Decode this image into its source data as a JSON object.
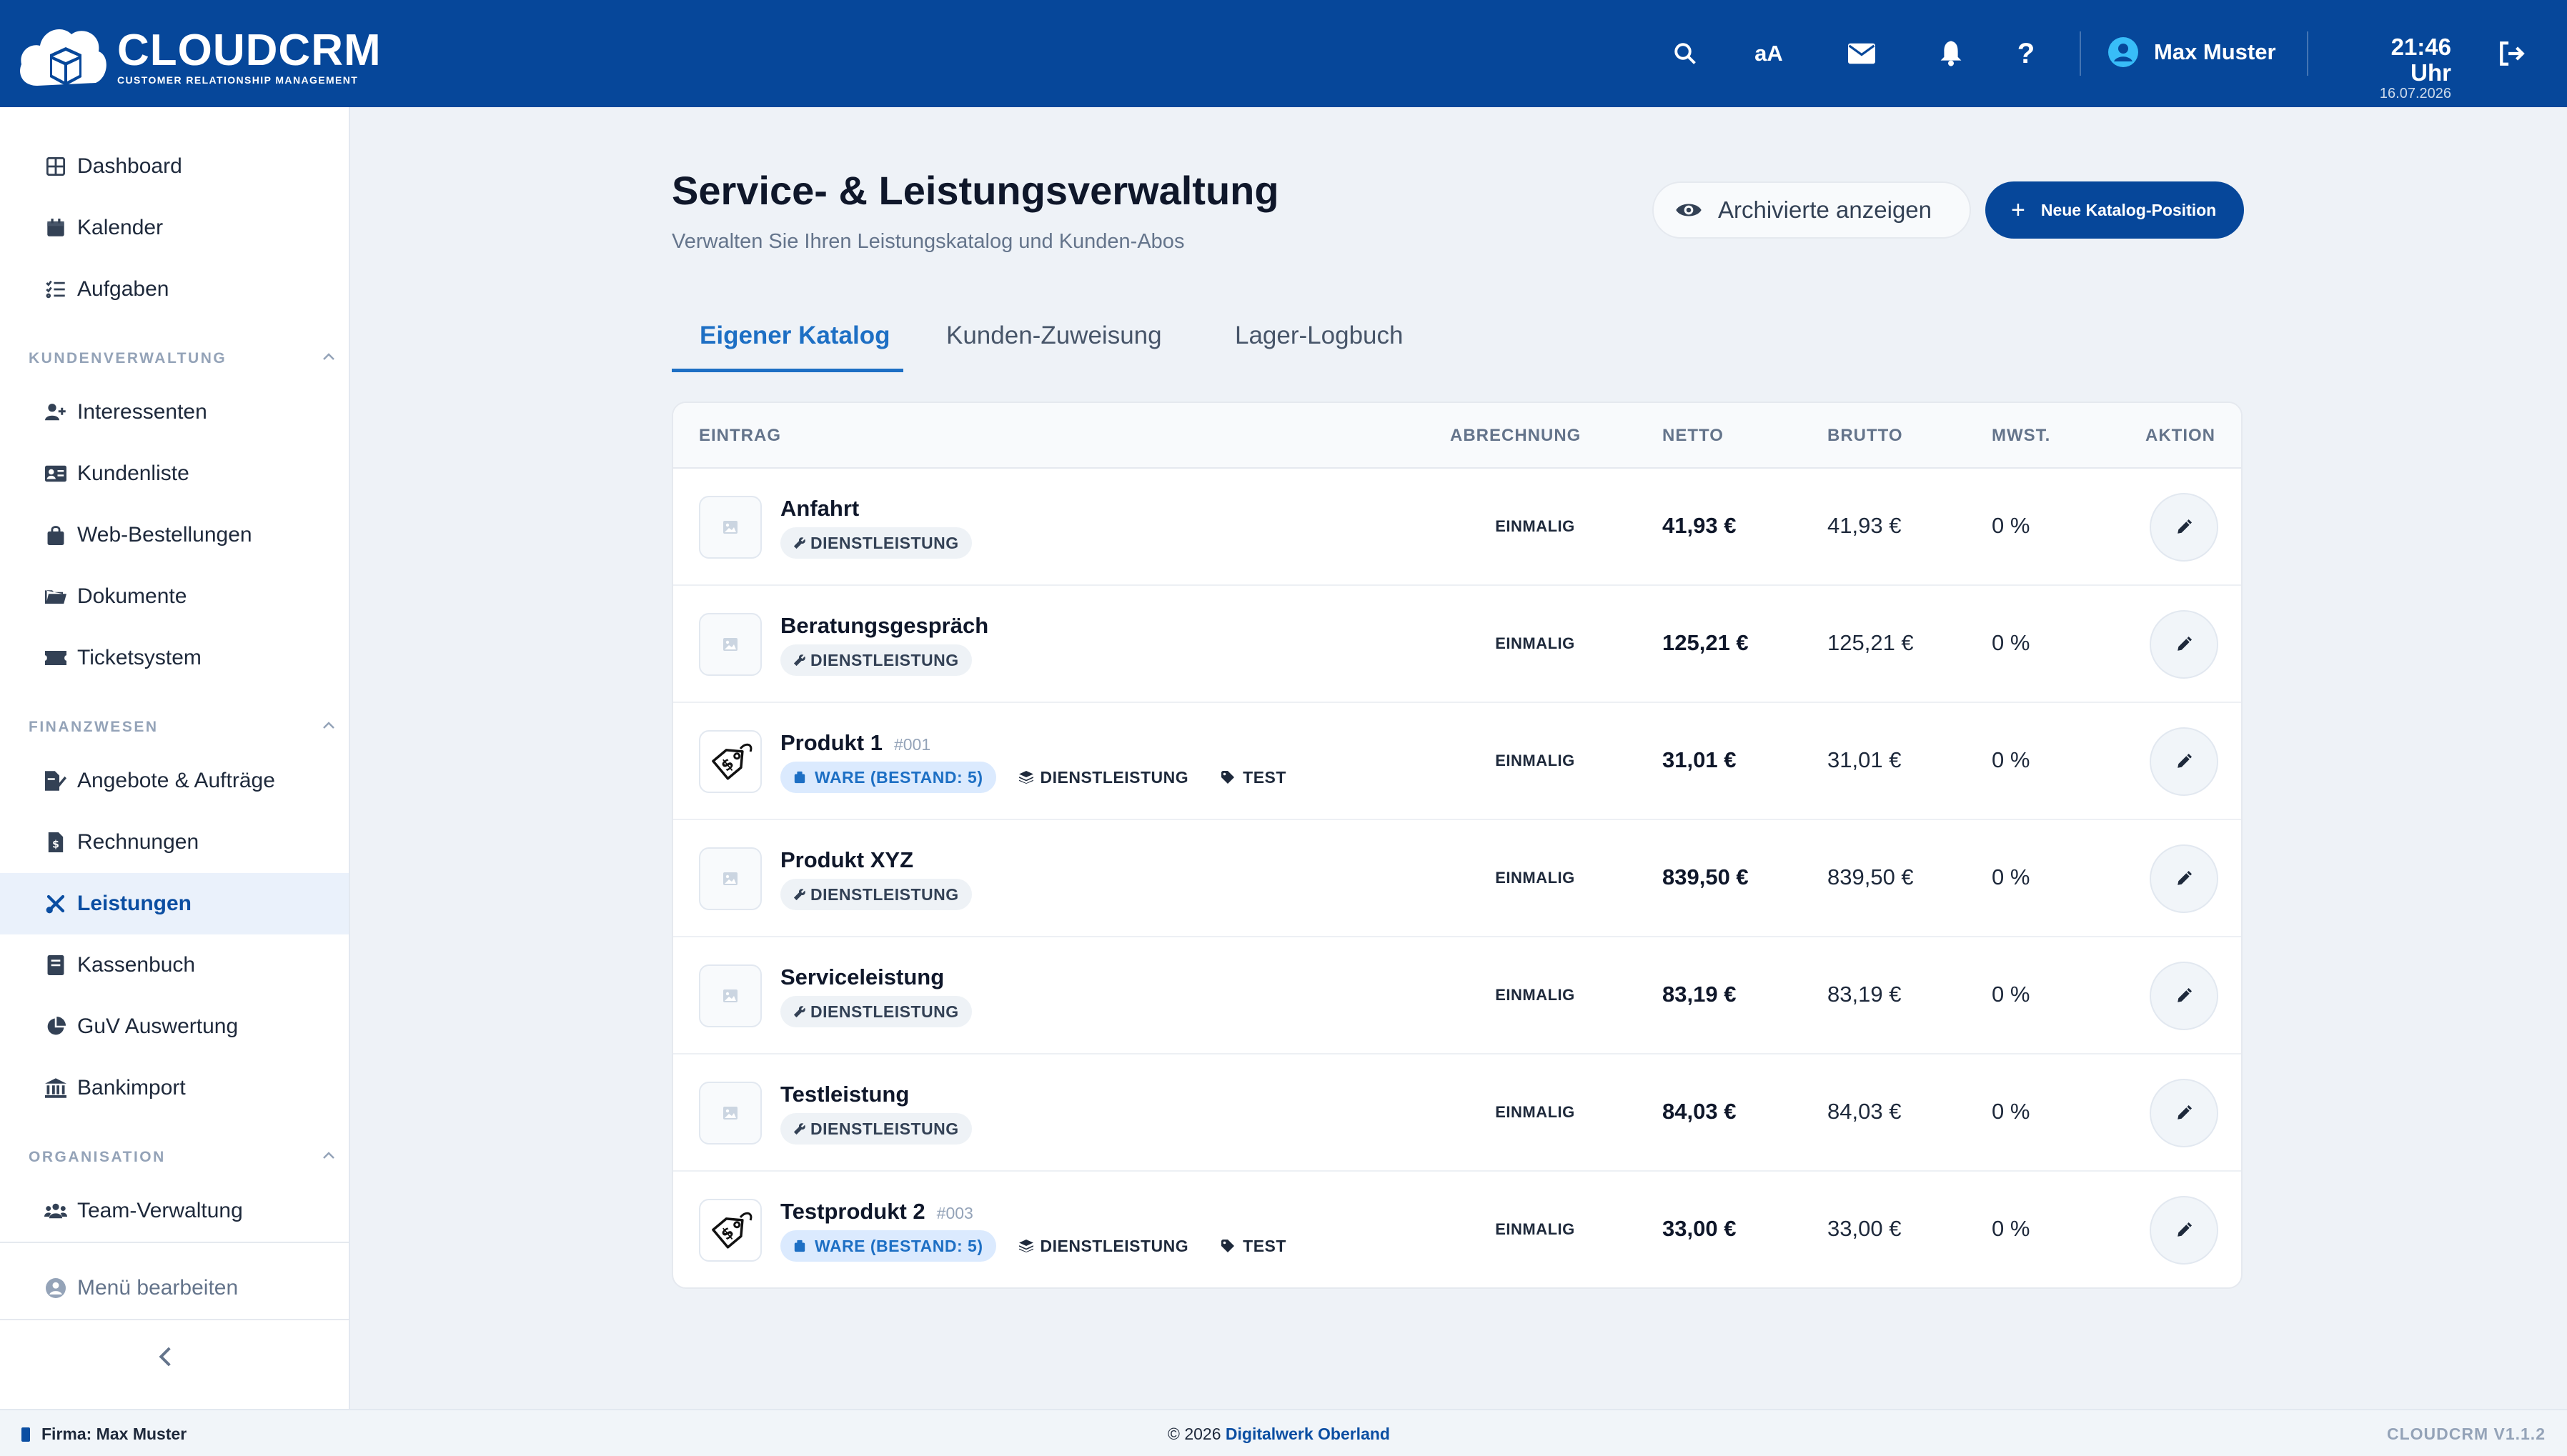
{
  "brand": {
    "name": "CLOUDCRM",
    "tagline": "CUSTOMER RELATIONSHIP MANAGEMENT"
  },
  "topbar": {
    "icons": [
      "search-icon",
      "font-size-icon",
      "mail-icon",
      "bell-icon",
      "help-icon",
      "logout-icon"
    ],
    "font_size_label": "aA",
    "user_name": "Max Muster",
    "time": "21:46 Uhr",
    "date": "16.07.2026"
  },
  "sidebar": {
    "top_items": [
      {
        "label": "Dashboard",
        "icon": "dashboard-icon"
      },
      {
        "label": "Kalender",
        "icon": "calendar-icon"
      },
      {
        "label": "Aufgaben",
        "icon": "tasks-icon"
      }
    ],
    "sections": [
      {
        "title": "KUNDENVERWALTUNG",
        "items": [
          {
            "label": "Interessenten",
            "icon": "user-plus-icon"
          },
          {
            "label": "Kundenliste",
            "icon": "id-card-icon"
          },
          {
            "label": "Web-Bestellungen",
            "icon": "shopping-bag-icon"
          },
          {
            "label": "Dokumente",
            "icon": "folder-icon"
          },
          {
            "label": "Ticketsystem",
            "icon": "ticket-icon"
          }
        ]
      },
      {
        "title": "FINANZWESEN",
        "items": [
          {
            "label": "Angebote & Aufträge",
            "icon": "file-signature-icon"
          },
          {
            "label": "Rechnungen",
            "icon": "invoice-icon"
          },
          {
            "label": "Leistungen",
            "icon": "tools-icon",
            "active": true
          },
          {
            "label": "Kassenbuch",
            "icon": "book-icon"
          },
          {
            "label": "GuV Auswertung",
            "icon": "pie-chart-icon"
          },
          {
            "label": "Bankimport",
            "icon": "bank-icon"
          }
        ]
      },
      {
        "title": "ORGANISATION",
        "items": [
          {
            "label": "Team-Verwaltung",
            "icon": "team-icon"
          }
        ]
      }
    ],
    "edit_menu": "Menü bearbeiten"
  },
  "page": {
    "title": "Service- & Leistungsverwaltung",
    "subtitle": "Verwalten Sie Ihren Leistungskatalog und Kunden-Abos",
    "archived_button": "Archivierte anzeigen",
    "new_button": "Neue Katalog-Position",
    "tabs": [
      "Eigener Katalog",
      "Kunden-Zuweisung",
      "Lager-Logbuch"
    ],
    "active_tab": "Eigener Katalog"
  },
  "table": {
    "headers": {
      "entry": "EINTRAG",
      "billing": "ABRECHNUNG",
      "net": "NETTO",
      "gross": "BRUTTO",
      "tax": "MWST.",
      "action": "AKTION"
    },
    "rows": [
      {
        "name": "Anfahrt",
        "sku": "",
        "thumb": "placeholder",
        "badges": [
          {
            "type": "service",
            "label": "DIENSTLEISTUNG"
          }
        ],
        "billing": "EINMALIG",
        "net": "41,93 €",
        "gross": "41,93 €",
        "tax": "0 %"
      },
      {
        "name": "Beratungsgespräch",
        "sku": "",
        "thumb": "placeholder",
        "badges": [
          {
            "type": "service",
            "label": "DIENSTLEISTUNG"
          }
        ],
        "billing": "EINMALIG",
        "net": "125,21 €",
        "gross": "125,21 €",
        "tax": "0 %"
      },
      {
        "name": "Produkt 1",
        "sku": "#001",
        "thumb": "price-tag",
        "badges": [
          {
            "type": "ware",
            "label": "WARE (BESTAND: 5)"
          },
          {
            "type": "layers",
            "label": "DIENSTLEISTUNG"
          },
          {
            "type": "tag",
            "label": "TEST"
          }
        ],
        "billing": "EINMALIG",
        "net": "31,01 €",
        "gross": "31,01 €",
        "tax": "0 %"
      },
      {
        "name": "Produkt XYZ",
        "sku": "",
        "thumb": "placeholder",
        "badges": [
          {
            "type": "service",
            "label": "DIENSTLEISTUNG"
          }
        ],
        "billing": "EINMALIG",
        "net": "839,50 €",
        "gross": "839,50 €",
        "tax": "0 %"
      },
      {
        "name": "Serviceleistung",
        "sku": "",
        "thumb": "placeholder",
        "badges": [
          {
            "type": "service",
            "label": "DIENSTLEISTUNG"
          }
        ],
        "billing": "EINMALIG",
        "net": "83,19 €",
        "gross": "83,19 €",
        "tax": "0 %"
      },
      {
        "name": "Testleistung",
        "sku": "",
        "thumb": "placeholder",
        "badges": [
          {
            "type": "service",
            "label": "DIENSTLEISTUNG"
          }
        ],
        "billing": "EINMALIG",
        "net": "84,03 €",
        "gross": "84,03 €",
        "tax": "0 %"
      },
      {
        "name": "Testprodukt 2",
        "sku": "#003",
        "thumb": "price-tag",
        "badges": [
          {
            "type": "ware",
            "label": "WARE (BESTAND: 5)"
          },
          {
            "type": "layers",
            "label": "DIENSTLEISTUNG"
          },
          {
            "type": "tag",
            "label": "TEST"
          }
        ],
        "billing": "EINMALIG",
        "net": "33,00 €",
        "gross": "33,00 €",
        "tax": "0 %"
      }
    ]
  },
  "footer": {
    "firma": "Firma: Max Muster",
    "copyright_prefix": "© 2026",
    "company": "Digitalwerk Oberland",
    "version": "CLOUDCRM V1.1.2"
  },
  "colors": {
    "primary": "#06479a",
    "accent": "#1d6fc4",
    "background": "#eef2f7"
  }
}
